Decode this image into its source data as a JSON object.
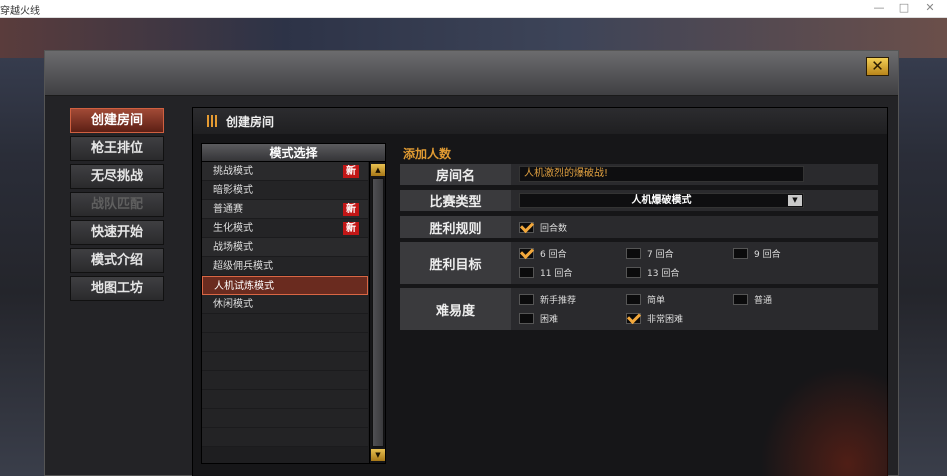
{
  "window": {
    "title": "穿越火线",
    "min_icon": "minimize-icon",
    "max_icon": "maximize-icon",
    "close_icon": "close-icon"
  },
  "dialog": {
    "close_icon": "close-x-icon"
  },
  "nav": {
    "items": [
      {
        "label": "创建房间",
        "state": "active"
      },
      {
        "label": "枪王排位",
        "state": "normal"
      },
      {
        "label": "无尽挑战",
        "state": "normal"
      },
      {
        "label": "战队匹配",
        "state": "disabled"
      },
      {
        "label": "快速开始",
        "state": "normal"
      },
      {
        "label": "模式介绍",
        "state": "normal"
      },
      {
        "label": "地图工坊",
        "state": "normal"
      }
    ]
  },
  "panel": {
    "title": "创建房间"
  },
  "modes": {
    "header": "模式选择",
    "new_badge": "新",
    "items": [
      {
        "label": "挑战模式",
        "new": true
      },
      {
        "label": "暗影模式",
        "new": false
      },
      {
        "label": "普通赛",
        "new": true
      },
      {
        "label": "生化模式",
        "new": true
      },
      {
        "label": "战场模式",
        "new": false
      },
      {
        "label": "超级佣兵模式",
        "new": false
      },
      {
        "label": "人机试炼模式",
        "new": false,
        "selected": true
      },
      {
        "label": "休闲模式",
        "new": false
      }
    ]
  },
  "settings": {
    "section_title": "添加人数",
    "room_name": {
      "label": "房间名",
      "value": "人机激烈的爆破战!"
    },
    "match_type": {
      "label": "比赛类型",
      "value": "人机爆破模式"
    },
    "win_rule": {
      "label": "胜利规则",
      "options": [
        {
          "label": "回合数",
          "checked": true
        }
      ]
    },
    "win_target": {
      "label": "胜利目标",
      "options": [
        {
          "label": "6 回合",
          "checked": true
        },
        {
          "label": "7 回合",
          "checked": false
        },
        {
          "label": "9 回合",
          "checked": false
        },
        {
          "label": "11 回合",
          "checked": false
        },
        {
          "label": "13 回合",
          "checked": false
        }
      ]
    },
    "difficulty": {
      "label": "难易度",
      "options": [
        {
          "label": "新手推荐",
          "checked": false
        },
        {
          "label": "简单",
          "checked": false
        },
        {
          "label": "普通",
          "checked": false
        },
        {
          "label": "困难",
          "checked": false
        },
        {
          "label": "非常困难",
          "checked": true
        }
      ]
    }
  },
  "colors": {
    "accent": "#e09a32",
    "active_nav": "#a14a36",
    "new_badge": "#c21616"
  }
}
